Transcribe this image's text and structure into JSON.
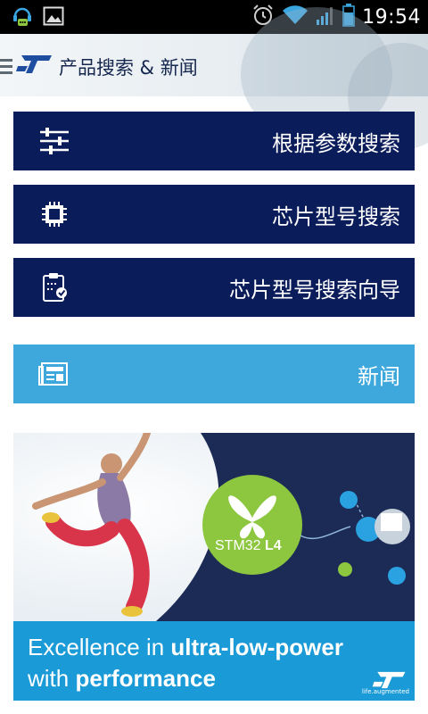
{
  "status_bar": {
    "time": "19:54",
    "icons": [
      "headset-chat-icon",
      "image-icon",
      "alarm-icon",
      "wifi-icon",
      "signal-icon",
      "battery-icon"
    ]
  },
  "action_bar": {
    "logo": "ST",
    "title": "产品搜索 & 新闻"
  },
  "menu": {
    "items": [
      {
        "label": "根据参数搜索",
        "icon": "sliders-icon"
      },
      {
        "label": "芯片型号搜索",
        "icon": "chip-icon"
      },
      {
        "label": "芯片型号搜索向导",
        "icon": "clipboard-check-icon"
      },
      {
        "label": "新闻",
        "icon": "newspaper-icon"
      }
    ]
  },
  "banner": {
    "product_label_a": "STM32",
    "product_label_b": "L4",
    "headline_line1_a": "Excellence in ",
    "headline_line1_b": "ultra-low-power",
    "headline_line2_a": "with ",
    "headline_line2_b": "performance",
    "logo": "ST",
    "logo_tag": "life.augmented"
  },
  "colors": {
    "status_bar": "#000000",
    "tile_dark": "#0b1c5b",
    "tile_news": "#3ea8dd",
    "banner_footer": "#1a9ad6",
    "stm_green": "#8dc63f",
    "banner_navy": "#1c2b55"
  }
}
